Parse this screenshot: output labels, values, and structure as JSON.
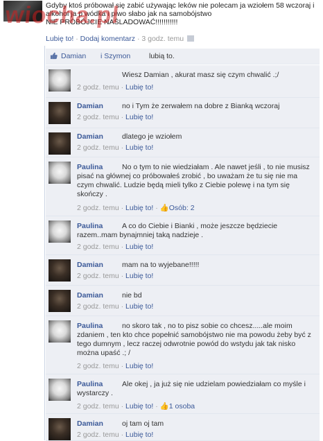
{
  "post": {
    "text_line1": "Gdyby ktoś próbował się zabić używając leków nie polecam ja wziołem 58 wczoraj i",
    "text_line2": "alkohol ja p             wódka i piwo słabo jak na samobójstwo",
    "text_line3": "NIE PRÓBÓJCIE NAŚLADOWAĆ!!!!!!!!!!!",
    "watermark": "wiocha.pl",
    "like_link": "Lubię to!",
    "comment_link": "Dodaj komentarz",
    "time": "3 godz. temu",
    "separator": "·"
  },
  "likes": {
    "name1": "Damian",
    "name2": "i Szymon",
    "suffix": "lubią to."
  },
  "comments": [
    {
      "name": "",
      "text": "Wiesz Damian , akurat masz się czym chwalić .;/",
      "time": "2 godz. temu",
      "like": "Lubię to!"
    },
    {
      "name": "Damian",
      "text": "no i Tym że zerwałem na dobre z Bianką wczoraj",
      "time": "2 godz. temu",
      "like": "Lubię to!"
    },
    {
      "name": "Damian",
      "text": "dlatego je wziołem",
      "time": "2 godz. temu",
      "like": "Lubię to!"
    },
    {
      "name": "Paulina",
      "text": "No o tym to nie wiedziałam . Ale nawet jeśli , to nie musisz pisać na głównej co próbowałeś zrobić , bo uważam że tu się nie ma czym chwalić. Ludzie będą mieli tylko z Ciebie polewę i na tym się skończy .",
      "time": "2 godz. temu",
      "like": "Lubię to!",
      "people": "Osób: 2"
    },
    {
      "name": "Paulina",
      "text": "A co do Ciebie i Bianki , może jeszcze będziecie razem..mam bynajmniej taką nadzieje .",
      "time": "2 godz. temu",
      "like": "Lubię to!"
    },
    {
      "name": "Damian",
      "text": "mam na to wyjebane!!!!!",
      "time": "2 godz. temu",
      "like": "Lubię to!"
    },
    {
      "name": "Damian",
      "text": "nie bd",
      "time": "2 godz. temu",
      "like": "Lubię to!"
    },
    {
      "name": "Paulina",
      "text": "no skoro tak , no to pisz sobie co chcesz.....ale moim zdaniem , ten kto chce popełnić samobójstwo nie ma powodu żeby być z tego dumnym , lecz raczej odwrotnie powód do wstydu jak tak nisko można upaść .; /",
      "time": "2 godz. temu",
      "like": "Lubię to!"
    },
    {
      "name": "Paulina",
      "text": "Ale okej , ja już się nie udzielam powiedziałam co myśle i wystarczy .",
      "time": "2 godz. temu",
      "like": "Lubię to!",
      "people": "1 osoba"
    },
    {
      "name": "Damian",
      "text": "oj tam oj tam",
      "time": "2 godz. temu",
      "like": "Lubię to!"
    }
  ]
}
